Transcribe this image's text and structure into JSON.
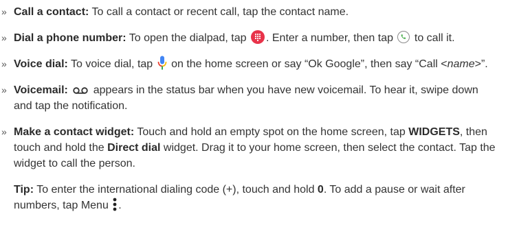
{
  "items": [
    {
      "label": "Call a contact:",
      "text": " To call a contact or recent call, tap the contact name."
    },
    {
      "label": "Dial a phone number:",
      "text_a": " To open the dialpad, tap ",
      "text_b": ". Enter a number, then tap ",
      "text_c": " to call it."
    },
    {
      "label": "Voice dial:",
      "text_a": " To voice dial, tap ",
      "text_b": " on the home screen or say “Ok Google”, then say “Call <",
      "italic": "name",
      "text_c": ">”."
    },
    {
      "label": "Voicemail:",
      "text": " appears in the status bar when you have new voicemail. To hear it, swipe down and tap the notification."
    },
    {
      "label": "Make a contact widget:",
      "text_a": " Touch and hold an empty spot on the home screen, tap ",
      "bold_a": "WIDGETS",
      "text_b": ", then touch and hold the ",
      "bold_b": "Direct dial",
      "text_c": " widget. Drag it to your home screen, then select the contact. Tap the widget to call the person."
    }
  ],
  "bullet": "»",
  "tip": {
    "label": "Tip:",
    "text_a": " To enter the international dialing code (+), touch and hold ",
    "bold": "0",
    "text_b": ". To add a pause or wait after numbers, tap Menu ",
    "text_c": "."
  },
  "icons": {
    "dialpad": "dialpad-icon",
    "call": "phone-call-icon",
    "mic": "microphone-icon",
    "voicemail": "voicemail-icon",
    "menu": "menu-dots-icon"
  },
  "colors": {
    "dialpad_bg": "#e8334a",
    "call_icon": "#4caf50",
    "mic_blue": "#4285f4",
    "mic_red": "#ea4335",
    "mic_yellow": "#fbbc05",
    "mic_green": "#34a853"
  }
}
